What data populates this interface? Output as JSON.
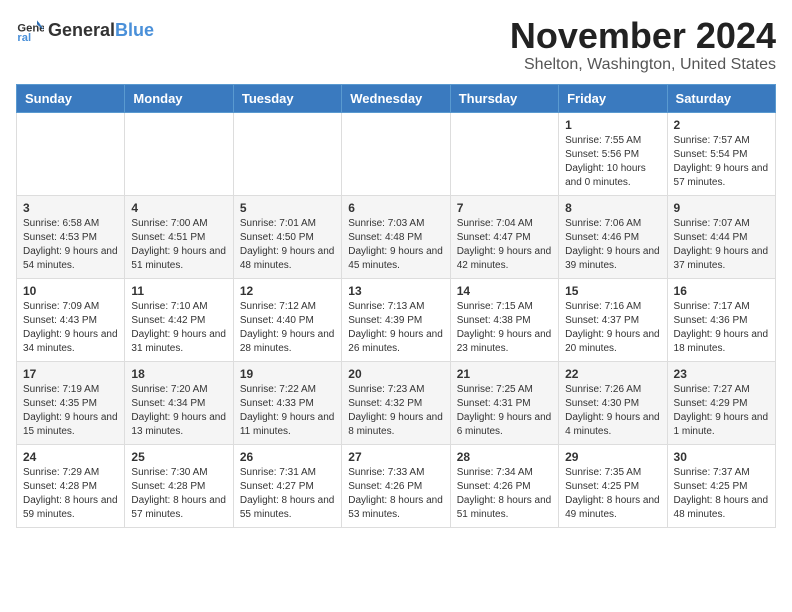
{
  "logo": {
    "general": "General",
    "blue": "Blue"
  },
  "title": {
    "month": "November 2024",
    "location": "Shelton, Washington, United States"
  },
  "weekdays": [
    "Sunday",
    "Monday",
    "Tuesday",
    "Wednesday",
    "Thursday",
    "Friday",
    "Saturday"
  ],
  "weeks": [
    [
      {
        "day": "",
        "info": ""
      },
      {
        "day": "",
        "info": ""
      },
      {
        "day": "",
        "info": ""
      },
      {
        "day": "",
        "info": ""
      },
      {
        "day": "",
        "info": ""
      },
      {
        "day": "1",
        "info": "Sunrise: 7:55 AM\nSunset: 5:56 PM\nDaylight: 10 hours and 0 minutes."
      },
      {
        "day": "2",
        "info": "Sunrise: 7:57 AM\nSunset: 5:54 PM\nDaylight: 9 hours and 57 minutes."
      }
    ],
    [
      {
        "day": "3",
        "info": "Sunrise: 6:58 AM\nSunset: 4:53 PM\nDaylight: 9 hours and 54 minutes."
      },
      {
        "day": "4",
        "info": "Sunrise: 7:00 AM\nSunset: 4:51 PM\nDaylight: 9 hours and 51 minutes."
      },
      {
        "day": "5",
        "info": "Sunrise: 7:01 AM\nSunset: 4:50 PM\nDaylight: 9 hours and 48 minutes."
      },
      {
        "day": "6",
        "info": "Sunrise: 7:03 AM\nSunset: 4:48 PM\nDaylight: 9 hours and 45 minutes."
      },
      {
        "day": "7",
        "info": "Sunrise: 7:04 AM\nSunset: 4:47 PM\nDaylight: 9 hours and 42 minutes."
      },
      {
        "day": "8",
        "info": "Sunrise: 7:06 AM\nSunset: 4:46 PM\nDaylight: 9 hours and 39 minutes."
      },
      {
        "day": "9",
        "info": "Sunrise: 7:07 AM\nSunset: 4:44 PM\nDaylight: 9 hours and 37 minutes."
      }
    ],
    [
      {
        "day": "10",
        "info": "Sunrise: 7:09 AM\nSunset: 4:43 PM\nDaylight: 9 hours and 34 minutes."
      },
      {
        "day": "11",
        "info": "Sunrise: 7:10 AM\nSunset: 4:42 PM\nDaylight: 9 hours and 31 minutes."
      },
      {
        "day": "12",
        "info": "Sunrise: 7:12 AM\nSunset: 4:40 PM\nDaylight: 9 hours and 28 minutes."
      },
      {
        "day": "13",
        "info": "Sunrise: 7:13 AM\nSunset: 4:39 PM\nDaylight: 9 hours and 26 minutes."
      },
      {
        "day": "14",
        "info": "Sunrise: 7:15 AM\nSunset: 4:38 PM\nDaylight: 9 hours and 23 minutes."
      },
      {
        "day": "15",
        "info": "Sunrise: 7:16 AM\nSunset: 4:37 PM\nDaylight: 9 hours and 20 minutes."
      },
      {
        "day": "16",
        "info": "Sunrise: 7:17 AM\nSunset: 4:36 PM\nDaylight: 9 hours and 18 minutes."
      }
    ],
    [
      {
        "day": "17",
        "info": "Sunrise: 7:19 AM\nSunset: 4:35 PM\nDaylight: 9 hours and 15 minutes."
      },
      {
        "day": "18",
        "info": "Sunrise: 7:20 AM\nSunset: 4:34 PM\nDaylight: 9 hours and 13 minutes."
      },
      {
        "day": "19",
        "info": "Sunrise: 7:22 AM\nSunset: 4:33 PM\nDaylight: 9 hours and 11 minutes."
      },
      {
        "day": "20",
        "info": "Sunrise: 7:23 AM\nSunset: 4:32 PM\nDaylight: 9 hours and 8 minutes."
      },
      {
        "day": "21",
        "info": "Sunrise: 7:25 AM\nSunset: 4:31 PM\nDaylight: 9 hours and 6 minutes."
      },
      {
        "day": "22",
        "info": "Sunrise: 7:26 AM\nSunset: 4:30 PM\nDaylight: 9 hours and 4 minutes."
      },
      {
        "day": "23",
        "info": "Sunrise: 7:27 AM\nSunset: 4:29 PM\nDaylight: 9 hours and 1 minute."
      }
    ],
    [
      {
        "day": "24",
        "info": "Sunrise: 7:29 AM\nSunset: 4:28 PM\nDaylight: 8 hours and 59 minutes."
      },
      {
        "day": "25",
        "info": "Sunrise: 7:30 AM\nSunset: 4:28 PM\nDaylight: 8 hours and 57 minutes."
      },
      {
        "day": "26",
        "info": "Sunrise: 7:31 AM\nSunset: 4:27 PM\nDaylight: 8 hours and 55 minutes."
      },
      {
        "day": "27",
        "info": "Sunrise: 7:33 AM\nSunset: 4:26 PM\nDaylight: 8 hours and 53 minutes."
      },
      {
        "day": "28",
        "info": "Sunrise: 7:34 AM\nSunset: 4:26 PM\nDaylight: 8 hours and 51 minutes."
      },
      {
        "day": "29",
        "info": "Sunrise: 7:35 AM\nSunset: 4:25 PM\nDaylight: 8 hours and 49 minutes."
      },
      {
        "day": "30",
        "info": "Sunrise: 7:37 AM\nSunset: 4:25 PM\nDaylight: 8 hours and 48 minutes."
      }
    ]
  ]
}
